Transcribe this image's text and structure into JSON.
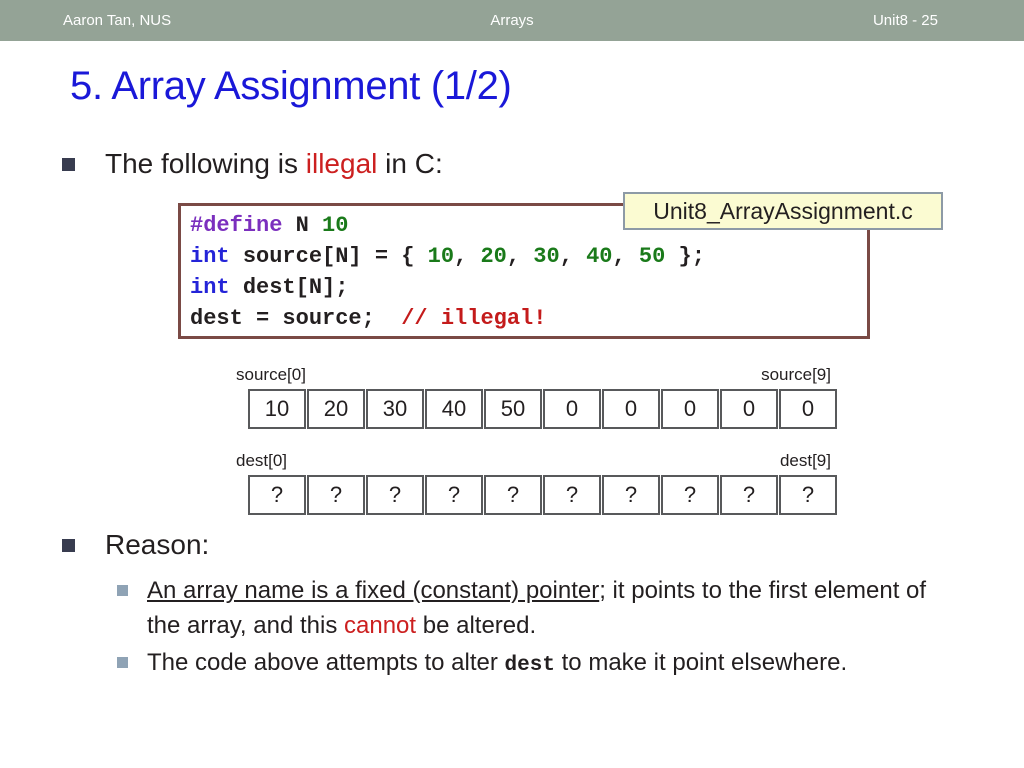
{
  "header": {
    "author": "Aaron Tan, NUS",
    "topic": "Arrays",
    "page": "Unit8 - 25"
  },
  "slide": {
    "title": "5. Array Assignment (1/2)"
  },
  "bullets": {
    "following": {
      "pre": "The following is ",
      "emphasis": "illegal",
      "post": " in C:"
    },
    "reason_heading": "Reason:",
    "reason_1": {
      "underlined": "An array name is a fixed (constant) pointer",
      "mid": "; it points to the first element of the array, and this ",
      "emphasis": "cannot",
      "post": " be altered."
    },
    "reason_2": {
      "pre": "The code above attempts to alter ",
      "code": "dest",
      "post": " to make it point elsewhere."
    }
  },
  "code": {
    "filename_callout": "Unit8_ArrayAssignment.c",
    "lines": [
      [
        {
          "t": "#define ",
          "c": "pre"
        },
        {
          "t": "N ",
          "c": "pln"
        },
        {
          "t": "10",
          "c": "num"
        }
      ],
      [
        {
          "t": "int ",
          "c": "kw"
        },
        {
          "t": "source[N] = { ",
          "c": "pln"
        },
        {
          "t": "10",
          "c": "num"
        },
        {
          "t": ", ",
          "c": "pln"
        },
        {
          "t": "20",
          "c": "num"
        },
        {
          "t": ", ",
          "c": "pln"
        },
        {
          "t": "30",
          "c": "num"
        },
        {
          "t": ", ",
          "c": "pln"
        },
        {
          "t": "40",
          "c": "num"
        },
        {
          "t": ", ",
          "c": "pln"
        },
        {
          "t": "50",
          "c": "num"
        },
        {
          "t": " };",
          "c": "pln"
        }
      ],
      [
        {
          "t": "int ",
          "c": "kw"
        },
        {
          "t": "dest[N];",
          "c": "pln"
        }
      ],
      [
        {
          "t": "dest = source;  ",
          "c": "pln"
        },
        {
          "t": "// illegal!",
          "c": "com"
        }
      ]
    ]
  },
  "arrays": [
    {
      "name": "source",
      "label_left": "source[0]",
      "label_right": "source[9]",
      "cells": [
        "10",
        "20",
        "30",
        "40",
        "50",
        "0",
        "0",
        "0",
        "0",
        "0"
      ]
    },
    {
      "name": "dest",
      "label_left": "dest[0]",
      "label_right": "dest[9]",
      "cells": [
        "?",
        "?",
        "?",
        "?",
        "?",
        "?",
        "?",
        "?",
        "?",
        "?"
      ]
    }
  ],
  "colors": {
    "header_bar": "#94a396",
    "title_blue": "#1a18d8",
    "emphasis_red": "#cc1f1f",
    "code_border": "#7a4a45",
    "callout_bg": "#fbfbd2",
    "callout_border": "#8d9aa6",
    "bullet_l1": "#383c4f",
    "bullet_l2": "#8fa3b5",
    "code_preproc": "#7b2fbe",
    "code_keyword": "#2424d8",
    "code_number": "#1a7a1a",
    "code_comment": "#c41b1b"
  }
}
